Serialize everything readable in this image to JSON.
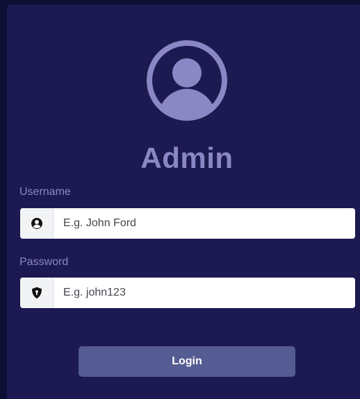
{
  "login": {
    "title": "Admin",
    "username": {
      "label": "Username",
      "placeholder": "E.g. John Ford",
      "value": "",
      "icon": "user-circle-icon"
    },
    "password": {
      "label": "Password",
      "placeholder": "E.g. john123",
      "value": "",
      "icon": "shield-icon"
    },
    "submit_label": "Login"
  },
  "colors": {
    "page_background": "#0d1035",
    "card_background": "#1d1a52",
    "accent": "#8b87c4",
    "button": "#555b93",
    "button_text": "#ffffff"
  }
}
